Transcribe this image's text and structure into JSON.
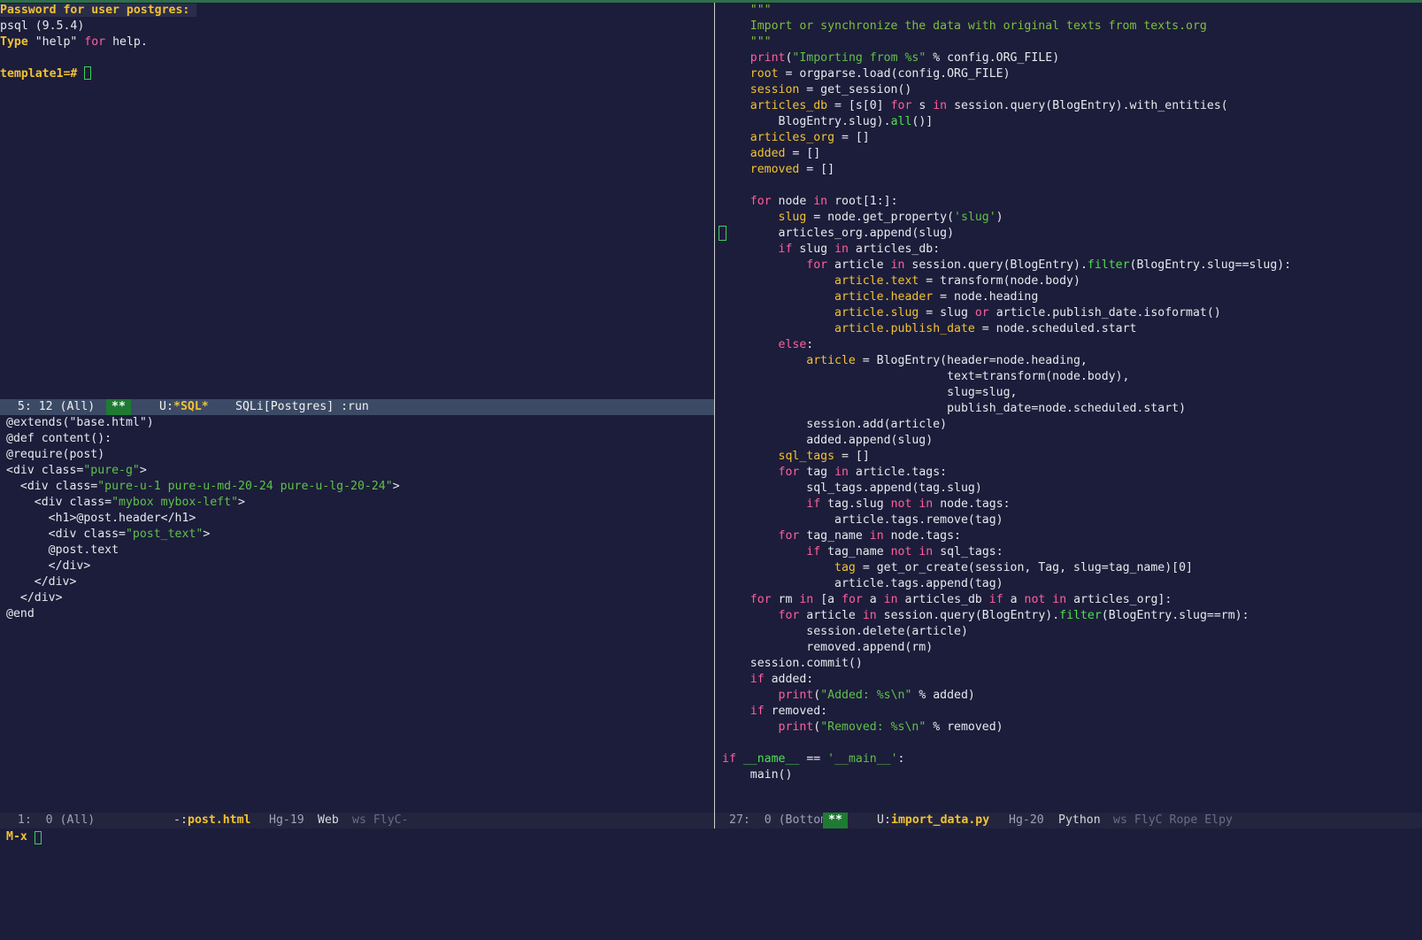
{
  "sql": {
    "password_prompt": "Password for user postgres:",
    "version": "psql (9.5.4)",
    "help_type": "Type",
    "help_quote": " \"help\" ",
    "help_for": "for",
    "help_end": " help.",
    "prompt": "template1=#"
  },
  "modeline_sql": {
    "position": "  5: 12 (All)",
    "stars": "**",
    "buffer_prefix": "U:",
    "buffer": "*SQL*",
    "mode": "SQLi[Postgres] :run"
  },
  "html_lines": [
    "@extends(\"base.html\")",
    "@def content():",
    "@require(post)",
    "<div class=\"pure-g\">",
    "  <div class=\"pure-u-1 pure-u-md-20-24 pure-u-lg-20-24\">",
    "    <div class=\"mybox mybox-left\">",
    "      <h1>@post.header</h1>",
    "      <div class=\"post_text\">",
    "      @post.text",
    "      </div>",
    "    </div>",
    "  </div>",
    "@end"
  ],
  "modeline_html": {
    "position": "  1:  0 (All)",
    "buffer_prefix": "-:",
    "buffer": "post.html",
    "vc": "Hg-19",
    "mode": "Web",
    "minor": "ws FlyC-"
  },
  "python_lines": [
    "    \"\"\"",
    "    Import or synchronize the data with original texts from texts.org",
    "    \"\"\"",
    "    print(\"Importing from %s\" % config.ORG_FILE)",
    "    root = orgparse.load(config.ORG_FILE)",
    "    session = get_session()",
    "    articles_db = [s[0] for s in session.query(BlogEntry).with_entities(",
    "        BlogEntry.slug).all()]",
    "    articles_org = []",
    "    added = []",
    "    removed = []",
    "",
    "    for node in root[1:]:",
    "        slug = node.get_property('slug')",
    "        articles_org.append(slug)",
    "        if slug in articles_db:",
    "            for article in session.query(BlogEntry).filter(BlogEntry.slug==slug):",
    "                article.text = transform(node.body)",
    "                article.header = node.heading",
    "                article.slug = slug or article.publish_date.isoformat()",
    "                article.publish_date = node.scheduled.start",
    "        else:",
    "            article = BlogEntry(header=node.heading,",
    "                                text=transform(node.body),",
    "                                slug=slug,",
    "                                publish_date=node.scheduled.start)",
    "            session.add(article)",
    "            added.append(slug)",
    "        sql_tags = []",
    "        for tag in article.tags:",
    "            sql_tags.append(tag.slug)",
    "            if tag.slug not in node.tags:",
    "                article.tags.remove(tag)",
    "        for tag_name in node.tags:",
    "            if tag_name not in sql_tags:",
    "                tag = get_or_create(session, Tag, slug=tag_name)[0]",
    "                article.tags.append(tag)",
    "    for rm in [a for a in articles_db if a not in articles_org]:",
    "        for article in session.query(BlogEntry).filter(BlogEntry.slug==rm):",
    "            session.delete(article)",
    "            removed.append(rm)",
    "    session.commit()",
    "    if added:",
    "        print(\"Added: %s\\n\" % added)",
    "    if removed:",
    "        print(\"Removed: %s\\n\" % removed)",
    "",
    "if __name__ == '__main__':",
    "    main()"
  ],
  "modeline_py": {
    "position": "27:  0 (Bottom)",
    "stars": "**",
    "buffer_prefix": "U:",
    "buffer": "import_data.py",
    "vc": "Hg-20",
    "mode": "Python",
    "minor": "ws FlyC Rope Elpy"
  },
  "minibuffer": {
    "label": "M-x"
  },
  "colors": {
    "background": "#1c1d3a",
    "keyword": "#ff5fa0",
    "string": "#5fc04a",
    "function": "#4fe04f",
    "variable": "#f2c230",
    "active_modeline": "#3c4a66"
  }
}
